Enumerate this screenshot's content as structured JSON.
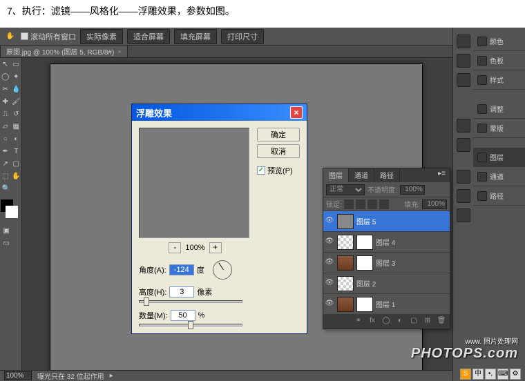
{
  "instruction": "7、执行：滤镜——风格化——浮雕效果，参数如图。",
  "options_bar": {
    "scroll_all": "滚动所有窗口",
    "actual_pixels": "实际像素",
    "fit_screen": "适合屏幕",
    "fill_screen": "填充屏幕",
    "print_size": "打印尺寸"
  },
  "doc_tab": "原图.jpg @ 100% (图层 5, RGB/8#)",
  "emboss": {
    "title": "浮雕效果",
    "ok": "确定",
    "cancel": "取消",
    "preview": "预览(P)",
    "zoom": "100%",
    "angle_label": "角度(A):",
    "angle_value": "-124",
    "angle_unit": "度",
    "height_label": "高度(H):",
    "height_value": "3",
    "height_unit": "像素",
    "amount_label": "数量(M):",
    "amount_value": "50",
    "amount_unit": "%"
  },
  "right_panels": {
    "labels": [
      "颜色",
      "色板",
      "样式",
      "调整",
      "蒙版",
      "图层",
      "通道",
      "路径"
    ]
  },
  "layers_panel": {
    "tabs": [
      "图层",
      "通道",
      "路径"
    ],
    "blend_mode": "正常",
    "opacity_label": "不透明度:",
    "opacity_value": "100%",
    "lock_label": "锁定:",
    "fill_label": "填充:",
    "fill_value": "100%",
    "layers": [
      "图层 5",
      "图层 4",
      "图层 3",
      "图层 2",
      "图层 1"
    ]
  },
  "status": {
    "zoom": "100%",
    "info": "曝光只在 32 位起作用"
  },
  "watermark": {
    "sub": "www.   照片处理网",
    "main": "PHOTOPS.com"
  }
}
